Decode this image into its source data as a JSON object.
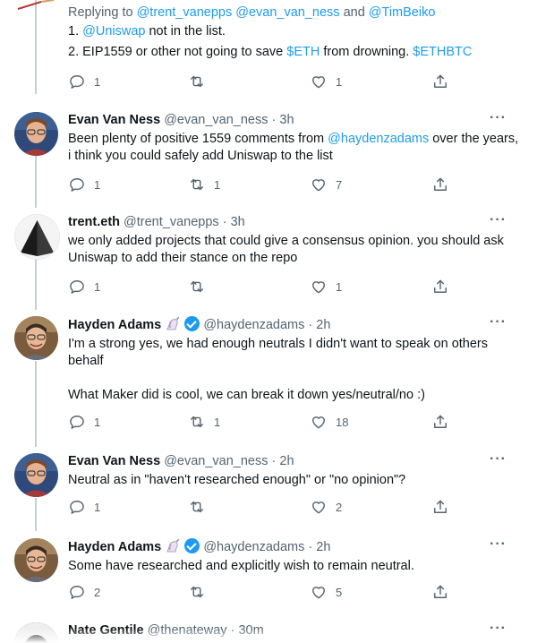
{
  "top_tweet": {
    "replying_prefix": "Replying to ",
    "replying_to": [
      "@trent_vanepps",
      "@evan_van_ness",
      "@TimBeiko"
    ],
    "replying_and": " and ",
    "line1_num": "1. ",
    "line1_mention": "@Uniswap",
    "line1_rest": " not in the list.",
    "line2_pre": "2. EIP1559 or other not going to save ",
    "line2_cashtag1": "$ETH",
    "line2_mid": " from drowning. ",
    "line2_cashtag2": "$ETHBTC",
    "reply_count": "1",
    "like_count": "1"
  },
  "tweets": [
    {
      "name": "Evan Van Ness",
      "handle": "@evan_van_ness",
      "time": "3h",
      "text_pre": "Been plenty of positive 1559 comments from ",
      "mention": "@haydenzadams",
      "text_post": " over the years, i think you could safely add Uniswap to the list",
      "reply_count": "1",
      "retweet_count": "1",
      "like_count": "7"
    },
    {
      "name": "trent.eth",
      "handle": "@trent_vanepps",
      "time": "3h",
      "text": "we only added projects that could give a consensus opinion. you should ask Uniswap to add their stance on the repo",
      "reply_count": "1",
      "like_count": "1"
    },
    {
      "name": "Hayden Adams",
      "handle": "@haydenzadams",
      "time": "2h",
      "text1": "I'm a strong yes, we had enough neutrals I didn't want to speak on others behalf",
      "text2": "What Maker did is cool, we can break it down yes/neutral/no :)",
      "reply_count": "1",
      "retweet_count": "1",
      "like_count": "18"
    },
    {
      "name": "Evan Van Ness",
      "handle": "@evan_van_ness",
      "time": "2h",
      "text": "Neutral as in \"haven't researched enough\" or \"no opinion\"?",
      "reply_count": "1",
      "like_count": "2"
    },
    {
      "name": "Hayden Adams",
      "handle": "@haydenzadams",
      "time": "2h",
      "text": "Some have researched and explicitly wish to remain neutral.",
      "reply_count": "2",
      "like_count": "5"
    },
    {
      "name": "Nate Gentile",
      "handle": "@thenateway",
      "time": "30m"
    }
  ],
  "dot": "·",
  "more_glyph": "···",
  "icons": [
    "reply-icon",
    "retweet-icon",
    "like-icon",
    "share-icon",
    "verified-badge-icon",
    "unicorn-emoji-icon"
  ],
  "colors": {
    "link": "#1d9bf0",
    "muted": "#536471",
    "text": "#0f1419",
    "thread_line": "#c4cfd6"
  }
}
